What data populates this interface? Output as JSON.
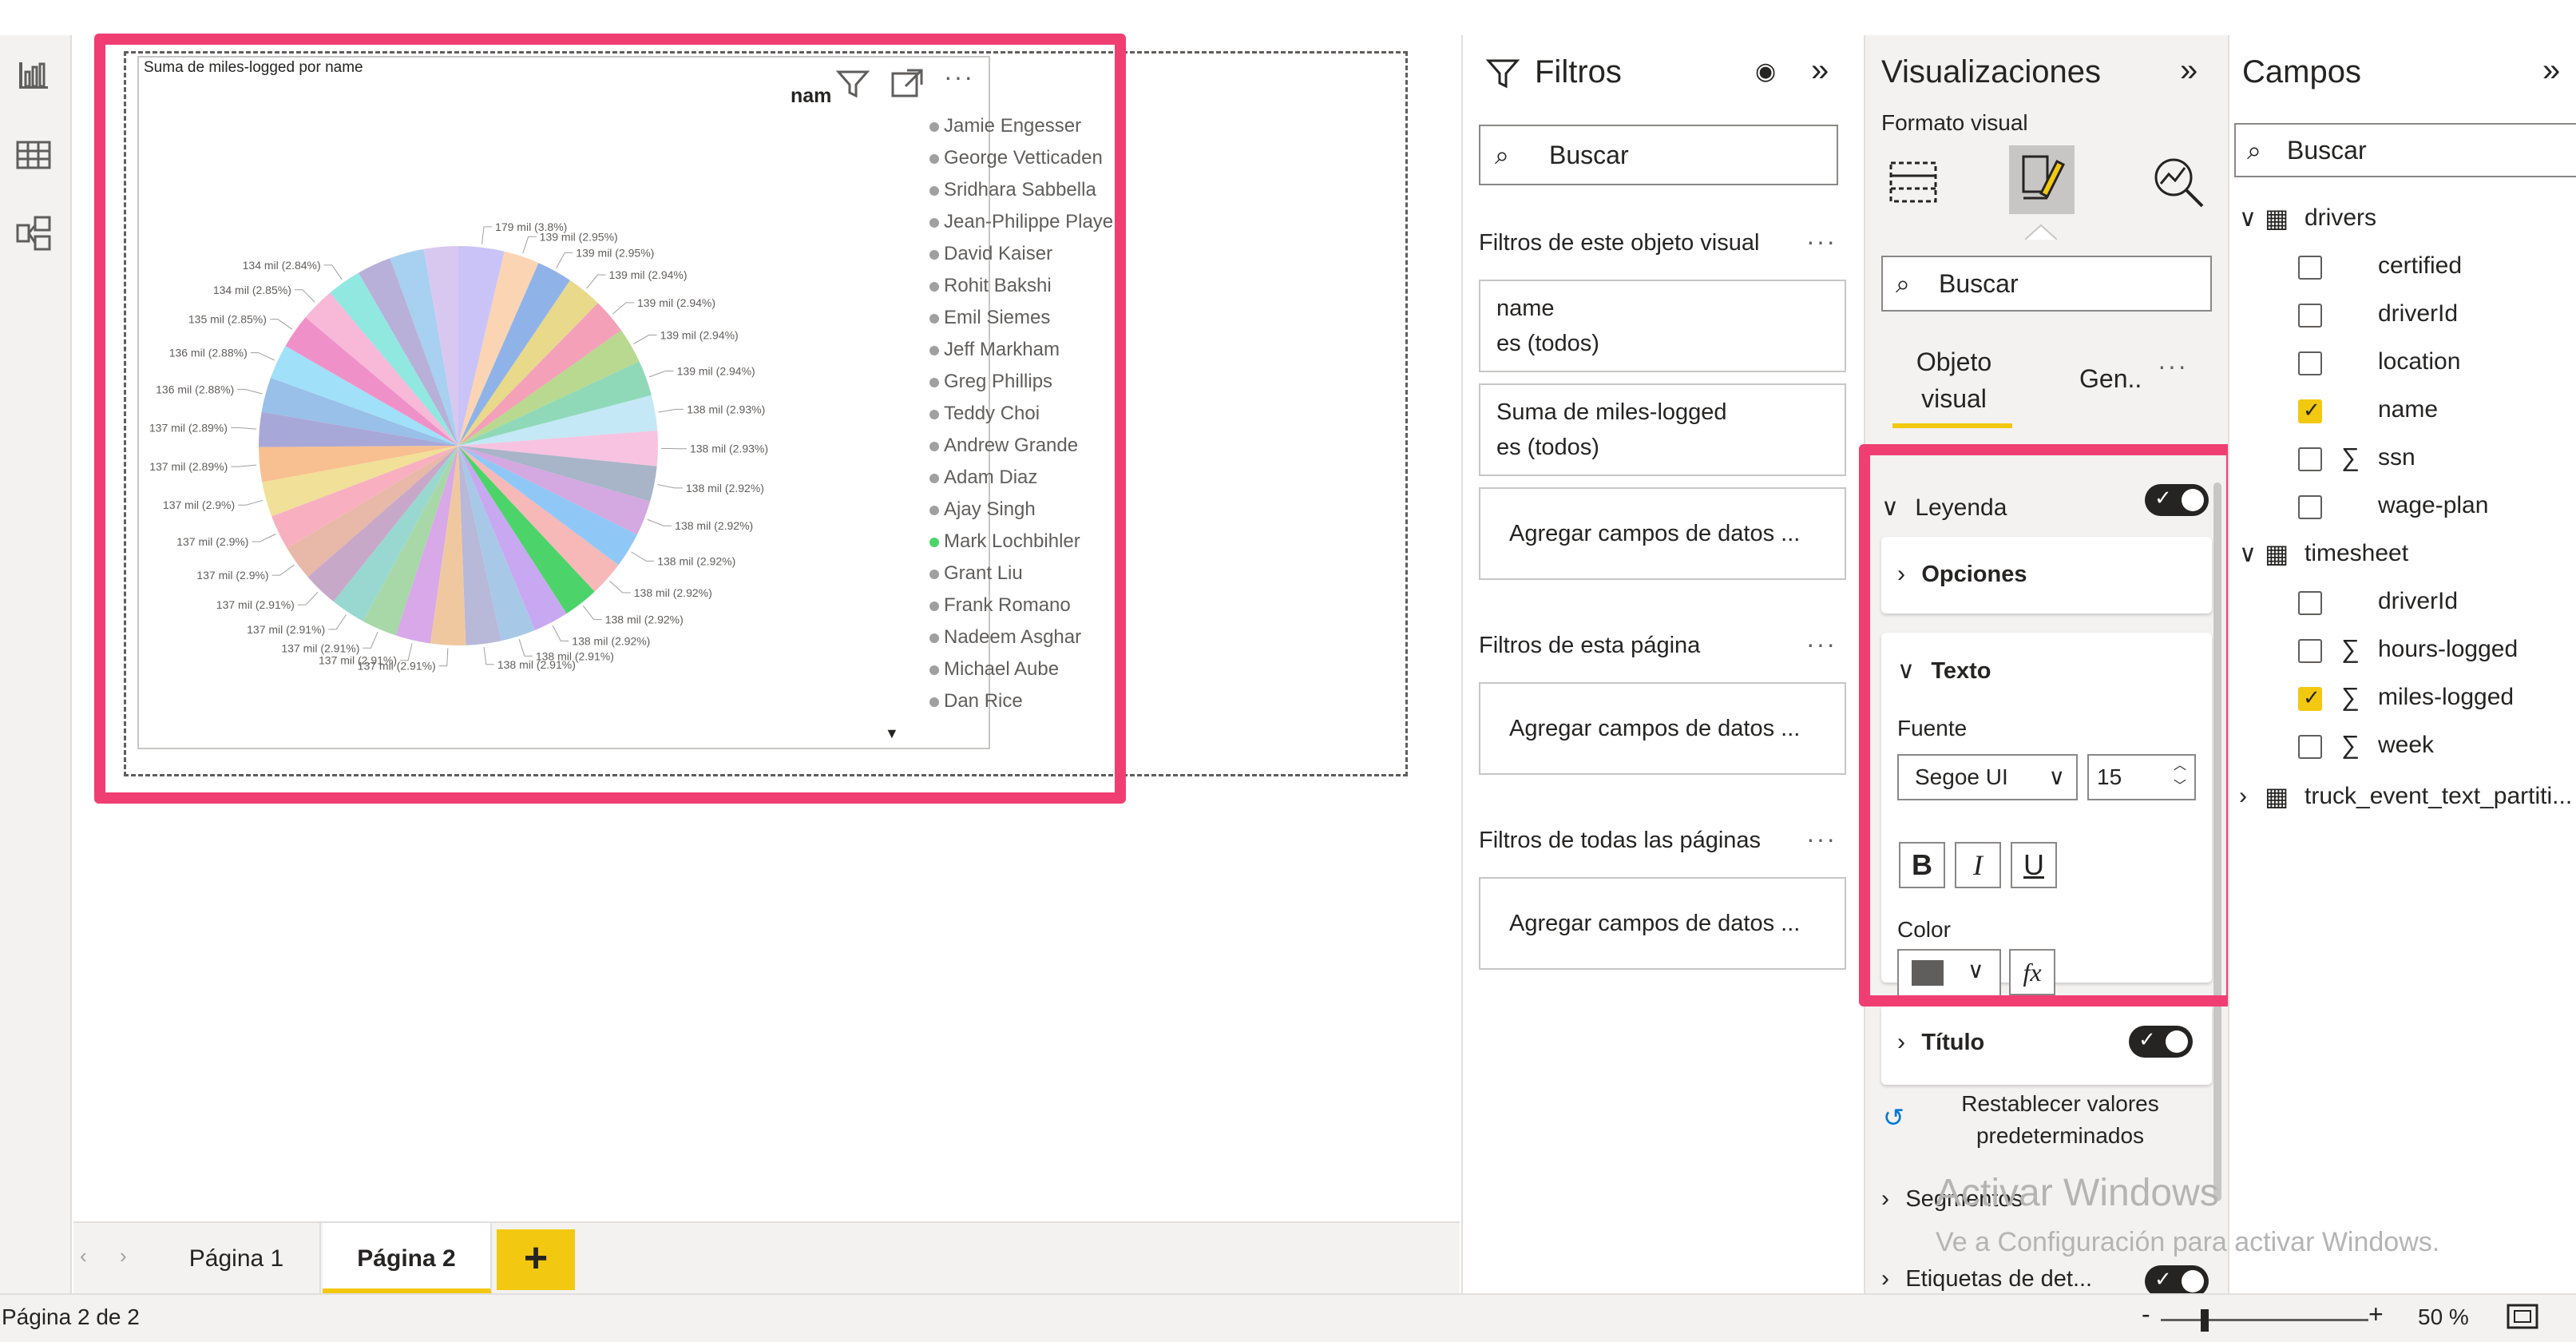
{
  "report_title": "Suma de miles-logged por name",
  "legend_header": "nam",
  "legend_names": [
    "Jamie Engesser",
    "George Vetticaden",
    "Sridhara Sabbella",
    "Jean-Philippe Playe",
    "David Kaiser",
    "Rohit Bakshi",
    "Emil Siemes",
    "Jeff Markham",
    "Greg Phillips",
    "Teddy Choi",
    "Andrew Grande",
    "Adam Diaz",
    "Ajay Singh",
    "Mark Lochbihler",
    "Grant Liu",
    "Frank Romano",
    "Nadeem Asghar",
    "Michael Aube",
    "Dan Rice"
  ],
  "chart_data": {
    "type": "pie",
    "title": "Suma de miles-logged por name",
    "slices": [
      {
        "label": "179 mil (3.8%)",
        "percent": 3.8,
        "color": "#c9c3f7"
      },
      {
        "label": "139 mil (2.95%)",
        "percent": 2.95,
        "color": "#fbd4b4"
      },
      {
        "label": "139 mil (2.95%)",
        "percent": 2.95,
        "color": "#8fb3e8"
      },
      {
        "label": "139 mil (2.94%)",
        "percent": 2.94,
        "color": "#e8d98b"
      },
      {
        "label": "139 mil (2.94%)",
        "percent": 2.94,
        "color": "#f4a0b8"
      },
      {
        "label": "139 mil (2.94%)",
        "percent": 2.94,
        "color": "#b8d98f"
      },
      {
        "label": "139 mil (2.94%)",
        "percent": 2.94,
        "color": "#8fd9b8"
      },
      {
        "label": "138 mil (2.93%)",
        "percent": 2.93,
        "color": "#c4e8f5"
      },
      {
        "label": "138 mil (2.93%)",
        "percent": 2.93,
        "color": "#f7c3e0"
      },
      {
        "label": "138 mil (2.92%)",
        "percent": 2.92,
        "color": "#a8b4c8"
      },
      {
        "label": "138 mil (2.92%)",
        "percent": 2.92,
        "color": "#d4a8e0"
      },
      {
        "label": "138 mil (2.92%)",
        "percent": 2.92,
        "color": "#8fc8f7"
      },
      {
        "label": "138 mil (2.92%)",
        "percent": 2.92,
        "color": "#f7b8b8"
      },
      {
        "label": "138 mil (2.92%)",
        "percent": 2.92,
        "color": "#4cd46a"
      },
      {
        "label": "138 mil (2.92%)",
        "percent": 2.92,
        "color": "#c8a8f0"
      },
      {
        "label": "138 mil (2.91%)",
        "percent": 2.91,
        "color": "#a8c8e8"
      },
      {
        "label": "138 mil (2.91%)",
        "percent": 2.91,
        "color": "#b8b8d8"
      },
      {
        "label": "137 mil (2.91%)",
        "percent": 2.91,
        "color": "#f0c8a0"
      },
      {
        "label": "137 mil (2.91%)",
        "percent": 2.91,
        "color": "#d8a8e8"
      },
      {
        "label": "137 mil (2.91%)",
        "percent": 2.91,
        "color": "#a8d8a8"
      },
      {
        "label": "137 mil (2.91%)",
        "percent": 2.91,
        "color": "#98d8d0"
      },
      {
        "label": "137 mil (2.91%)",
        "percent": 2.91,
        "color": "#c8a8c8"
      },
      {
        "label": "137 mil (2.9%)",
        "percent": 2.9,
        "color": "#e8b8a8"
      },
      {
        "label": "137 mil (2.9%)",
        "percent": 2.9,
        "color": "#f8b0c0"
      },
      {
        "label": "137 mil (2.9%)",
        "percent": 2.9,
        "color": "#f0e098"
      },
      {
        "label": "137 mil (2.89%)",
        "percent": 2.89,
        "color": "#f8c090"
      },
      {
        "label": "137 mil (2.89%)",
        "percent": 2.89,
        "color": "#a8a8d8"
      },
      {
        "label": "136 mil (2.88%)",
        "percent": 2.88,
        "color": "#98c0e8"
      },
      {
        "label": "136 mil (2.88%)",
        "percent": 2.88,
        "color": "#a0e0f8"
      },
      {
        "label": "135 mil (2.85%)",
        "percent": 2.85,
        "color": "#f090c8"
      },
      {
        "label": "134 mil (2.85%)",
        "percent": 2.85,
        "color": "#f8b8d8"
      },
      {
        "label": "134 mil (2.84%)",
        "percent": 2.84,
        "color": "#90e8e0"
      },
      {
        "label": "",
        "percent": 2.85,
        "color": "#b8b0d8"
      },
      {
        "label": "",
        "percent": 2.85,
        "color": "#a8d0f0"
      },
      {
        "label": "",
        "percent": 2.85,
        "color": "#d8c8f0"
      }
    ]
  },
  "filters_panel": {
    "title": "Filtros",
    "search_placeholder": "Buscar",
    "section_visual": "Filtros de este objeto visual",
    "card1_line1": "name",
    "card1_line2": "es (todos)",
    "card2_line1": "Suma de miles-logged",
    "card2_line2": "es (todos)",
    "add_fields": "Agregar campos de datos ...",
    "section_page": "Filtros de esta página",
    "section_all": "Filtros de todas las páginas"
  },
  "vis_panel": {
    "title": "Visualizaciones",
    "subtitle": "Formato visual",
    "search_placeholder": "Buscar",
    "tab_visual": "Objeto visual",
    "tab_general": "Gen..",
    "leyenda": "Leyenda",
    "opciones": "Opciones",
    "texto": "Texto",
    "fuente": "Fuente",
    "font_family": "Segoe UI",
    "font_size": "15",
    "bold": "B",
    "italic": "I",
    "underline": "U",
    "color_label": "Color",
    "fx": "fx",
    "titulo": "Título",
    "reset": "Restablecer valores predeterminados",
    "segmentos": "Segmentos",
    "etiquetas": "Etiquetas de det..."
  },
  "campos_panel": {
    "title": "Campos",
    "search_placeholder": "Buscar",
    "table_drivers": "drivers",
    "drivers_fields": [
      {
        "name": "certified",
        "checked": false,
        "sigma": false
      },
      {
        "name": "driverId",
        "checked": false,
        "sigma": false
      },
      {
        "name": "location",
        "checked": false,
        "sigma": false
      },
      {
        "name": "name",
        "checked": true,
        "sigma": false
      },
      {
        "name": "ssn",
        "checked": false,
        "sigma": true
      },
      {
        "name": "wage-plan",
        "checked": false,
        "sigma": false
      }
    ],
    "table_timesheet": "timesheet",
    "timesheet_fields": [
      {
        "name": "driverId",
        "checked": false,
        "sigma": false
      },
      {
        "name": "hours-logged",
        "checked": false,
        "sigma": true
      },
      {
        "name": "miles-logged",
        "checked": true,
        "sigma": true
      },
      {
        "name": "week",
        "checked": false,
        "sigma": true
      }
    ],
    "table_truck": "truck_event_text_partiti..."
  },
  "pages": {
    "tab1": "Página 1",
    "tab2": "Página 2",
    "add": "+"
  },
  "status": {
    "page_indicator": "Página 2 de 2",
    "zoom_minus": "-",
    "zoom_plus": "+",
    "zoom": "50 %"
  },
  "watermark": {
    "line1": "Activar Windows",
    "line2": "Ve a Configuración para activar Windows."
  }
}
